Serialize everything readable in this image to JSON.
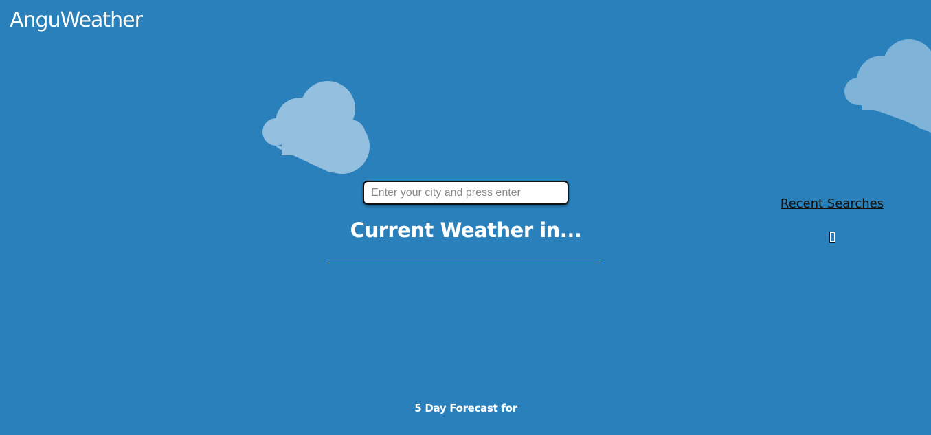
{
  "app": {
    "title": "AnguWeather"
  },
  "search": {
    "placeholder": "Enter your city and press enter",
    "value": ""
  },
  "current_weather": {
    "heading": "Current Weather in..."
  },
  "recent_searches": {
    "heading": "Recent Searches",
    "items": [],
    "empty_marker": "[]"
  },
  "forecast": {
    "heading": "5 Day Forecast for"
  },
  "colors": {
    "background": "#2a80ba",
    "cloud": "#94bfdf",
    "divider": "#e2b53c",
    "text": "#ffffff",
    "recent_heading": "#111111"
  },
  "icons": [
    "cloud-icon",
    "cloud-icon"
  ]
}
